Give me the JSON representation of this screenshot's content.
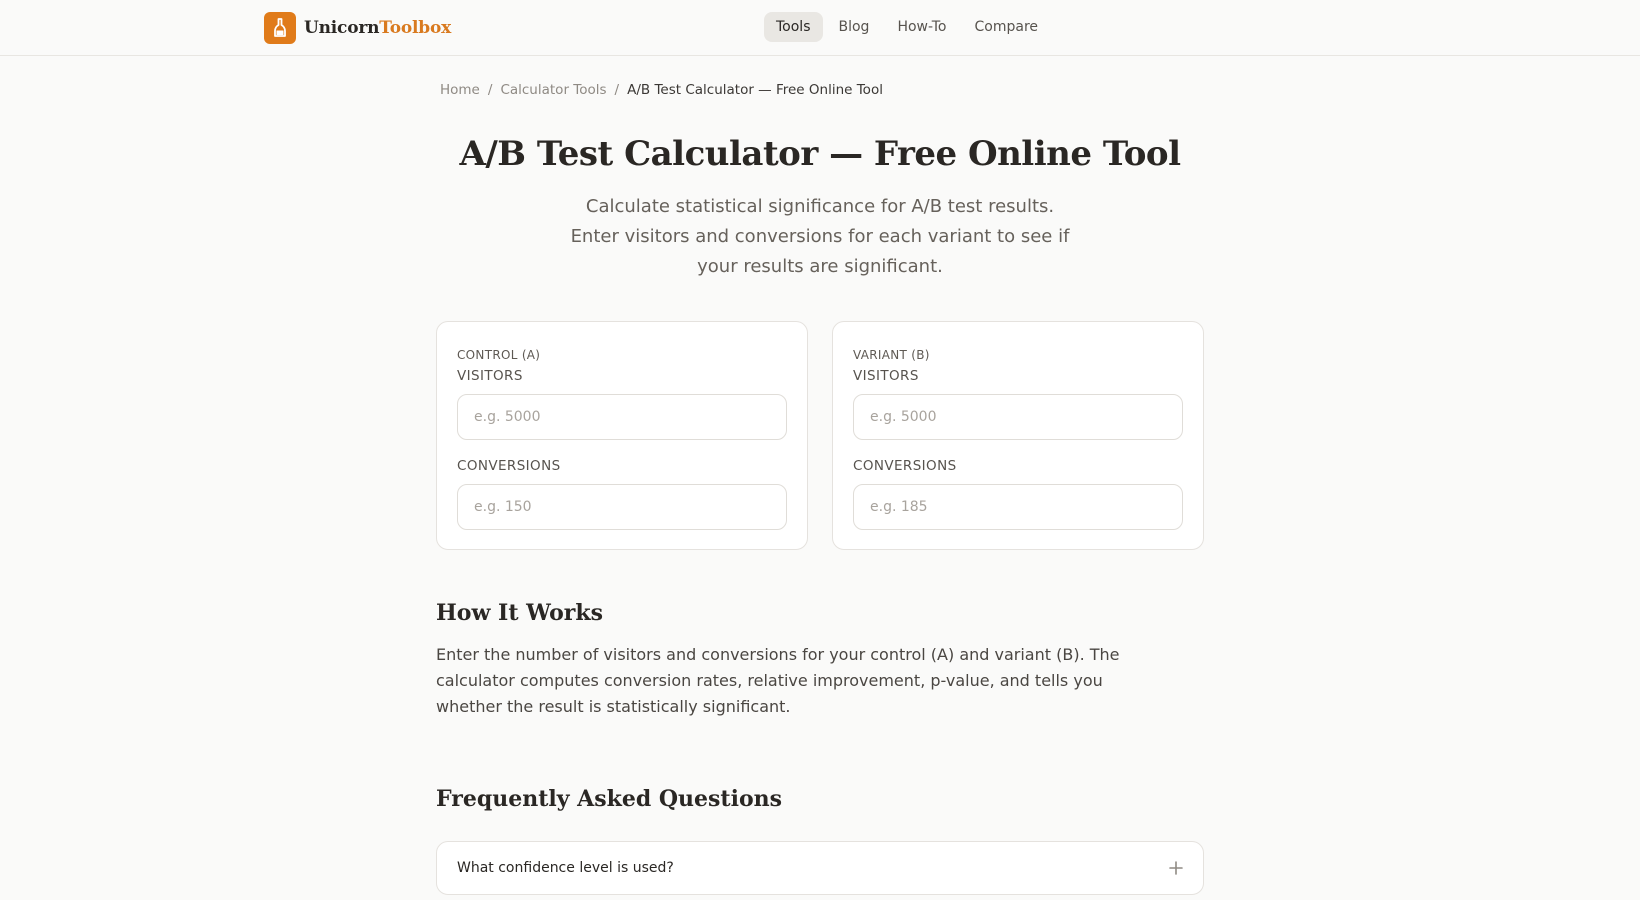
{
  "brand": {
    "name_main": "Unicorn",
    "name_accent": "Toolbox",
    "accent_color": "#e07b1a",
    "icon": "unicorn-bottle-icon"
  },
  "nav": {
    "items": [
      {
        "label": "Tools",
        "active": true
      },
      {
        "label": "Blog",
        "active": false
      },
      {
        "label": "How-To",
        "active": false
      },
      {
        "label": "Compare",
        "active": false
      }
    ]
  },
  "breadcrumb": {
    "items": [
      "Home",
      "Calculator Tools",
      "A/B Test Calculator — Free Online Tool"
    ],
    "separator": "/"
  },
  "page": {
    "title": "A/B Test Calculator — Free Online Tool",
    "subtitle": "Calculate statistical significance for A/B test results. Enter visitors and conversions for each variant to see if your results are significant."
  },
  "control": {
    "heading": "CONTROL (A)",
    "visitors_label": "VISITORS",
    "visitors_placeholder": "e.g. 5000",
    "visitors_value": "",
    "conversions_label": "CONVERSIONS",
    "conversions_placeholder": "e.g. 150",
    "conversions_value": ""
  },
  "variant": {
    "heading": "VARIANT (B)",
    "visitors_label": "VISITORS",
    "visitors_placeholder": "e.g. 5000",
    "visitors_value": "",
    "conversions_label": "CONVERSIONS",
    "conversions_placeholder": "e.g. 185",
    "conversions_value": ""
  },
  "how_it_works": {
    "heading": "How It Works",
    "body": "Enter the number of visitors and conversions for your control (A) and variant (B). The calculator computes conversion rates, relative improvement, p-value, and tells you whether the result is statistically significant."
  },
  "faq": {
    "heading": "Frequently Asked Questions",
    "items": [
      {
        "question": "What confidence level is used?",
        "icon": "plus-icon"
      }
    ]
  }
}
